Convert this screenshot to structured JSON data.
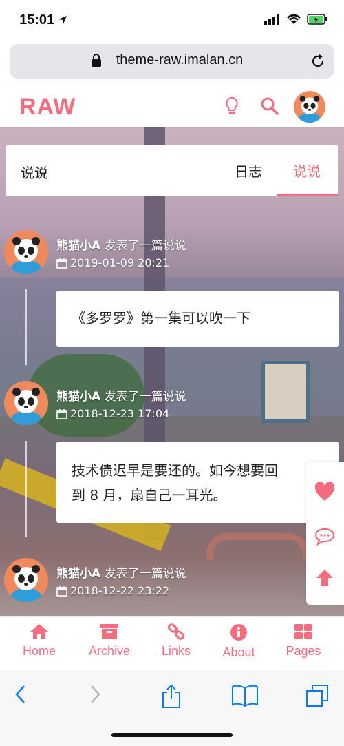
{
  "status": {
    "time": "15:01"
  },
  "browser": {
    "url": "theme-raw.imalan.cn"
  },
  "header": {
    "logo": "RAW"
  },
  "tabs": {
    "title": "说说",
    "items": [
      "日志",
      "说说"
    ]
  },
  "posts": [
    {
      "author": "熊猫小A",
      "action": "发表了一篇说说",
      "date": "2019-01-09 20:21",
      "content": [
        "《多罗罗》第一集可以吹一下"
      ]
    },
    {
      "author": "熊猫小A",
      "action": "发表了一篇说说",
      "date": "2018-12-23 17:04",
      "content": [
        "技术债迟早是要还的。如今想要回",
        "到 8 月，扇自己一耳光。"
      ]
    },
    {
      "author": "熊猫小A",
      "action": "发表了一篇说说",
      "date": "2018-12-22 23:22",
      "content": []
    }
  ],
  "bottom_nav": [
    {
      "label": "Home",
      "icon": "home-icon"
    },
    {
      "label": "Archive",
      "icon": "archive-icon"
    },
    {
      "label": "Links",
      "icon": "link-icon"
    },
    {
      "label": "About",
      "icon": "info-icon"
    },
    {
      "label": "Pages",
      "icon": "grid-icon"
    }
  ],
  "colors": {
    "accent": "#f56c7e",
    "ios_blue": "#007aff"
  }
}
